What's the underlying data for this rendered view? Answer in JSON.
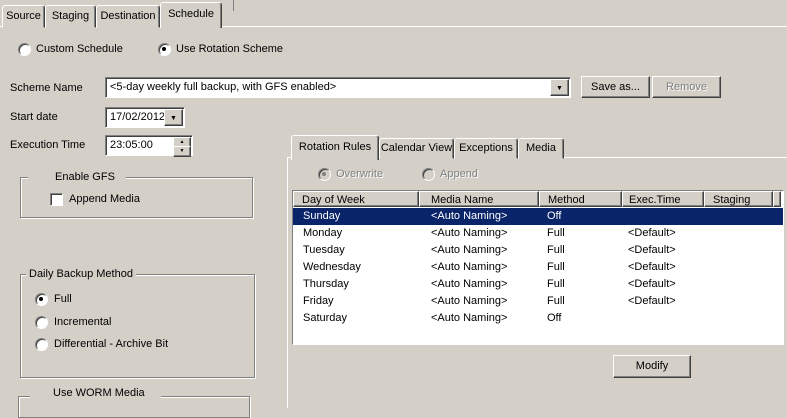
{
  "window": {
    "bg": "#d4d0c8",
    "selection_color": "#0a246a",
    "field_bg": "#ffffff",
    "disabled_text": "#808080"
  },
  "tabs": {
    "items": [
      {
        "label": "Source"
      },
      {
        "label": "Staging"
      },
      {
        "label": "Destination"
      },
      {
        "label": "Schedule"
      }
    ],
    "active": "Schedule"
  },
  "schedule_mode": {
    "custom": {
      "label": "Custom Schedule",
      "selected": false
    },
    "rotation": {
      "label": "Use Rotation Scheme",
      "selected": true
    }
  },
  "scheme_name": {
    "label": "Scheme Name",
    "value": "<5-day weekly full backup, with GFS enabled>"
  },
  "buttons": {
    "save_as": "Save as...",
    "remove": "Remove",
    "modify": "Modify"
  },
  "start_date": {
    "label": "Start date",
    "value": "17/02/2012"
  },
  "execution_time": {
    "label": "Execution Time",
    "value": "23:05:00"
  },
  "gfs": {
    "label": "Enable GFS",
    "checked": true,
    "append_media": {
      "label": "Append Media",
      "checked": false
    }
  },
  "daily_backup_method": {
    "title": "Daily Backup Method",
    "options": [
      {
        "label": "Full",
        "selected": true
      },
      {
        "label": "Incremental",
        "selected": false
      },
      {
        "label": "Differential - Archive Bit",
        "selected": false
      }
    ]
  },
  "worm_media": {
    "label": "Use WORM Media",
    "checked": false
  },
  "rotation": {
    "tabs": [
      {
        "label": "Rotation Rules"
      },
      {
        "label": "Calendar View"
      },
      {
        "label": "Exceptions"
      },
      {
        "label": "Media"
      }
    ],
    "active_tab": "Rotation Rules",
    "mode": {
      "overwrite": {
        "label": "Overwrite",
        "selected": true,
        "enabled": false
      },
      "append": {
        "label": "Append",
        "selected": false,
        "enabled": false
      }
    },
    "table": {
      "columns": [
        {
          "label": "Day of Week"
        },
        {
          "label": "Media Name"
        },
        {
          "label": "Method"
        },
        {
          "label": "Exec.Time"
        },
        {
          "label": "Staging"
        }
      ],
      "rows": [
        {
          "day": "Sunday",
          "media": "<Auto Naming>",
          "method": "Off",
          "exec_time": "",
          "staging": "",
          "selected": true
        },
        {
          "day": "Monday",
          "media": "<Auto Naming>",
          "method": "Full",
          "exec_time": "<Default>",
          "staging": "",
          "selected": false
        },
        {
          "day": "Tuesday",
          "media": "<Auto Naming>",
          "method": "Full",
          "exec_time": "<Default>",
          "staging": "",
          "selected": false
        },
        {
          "day": "Wednesday",
          "media": "<Auto Naming>",
          "method": "Full",
          "exec_time": "<Default>",
          "staging": "",
          "selected": false
        },
        {
          "day": "Thursday",
          "media": "<Auto Naming>",
          "method": "Full",
          "exec_time": "<Default>",
          "staging": "",
          "selected": false
        },
        {
          "day": "Friday",
          "media": "<Auto Naming>",
          "method": "Full",
          "exec_time": "<Default>",
          "staging": "",
          "selected": false
        },
        {
          "day": "Saturday",
          "media": "<Auto Naming>",
          "method": "Off",
          "exec_time": "",
          "staging": "",
          "selected": false
        }
      ]
    }
  }
}
